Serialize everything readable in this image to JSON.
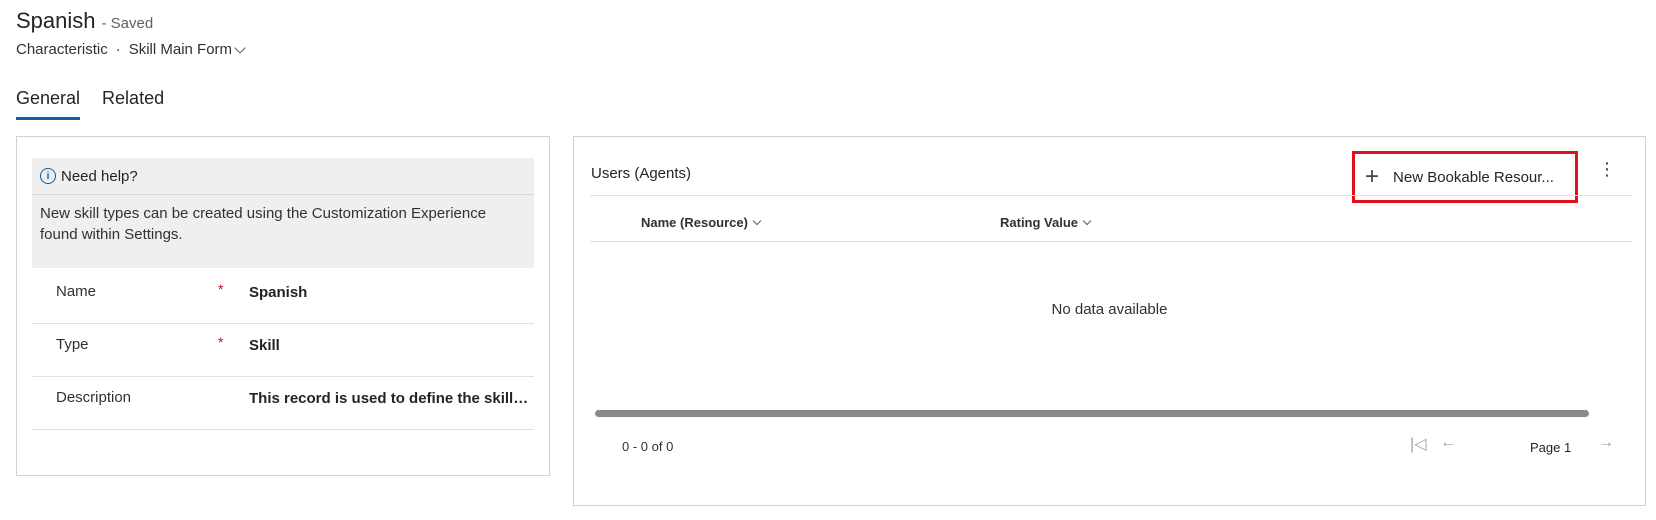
{
  "header": {
    "title": "Spanish",
    "status": "- Saved",
    "entity": "Characteristic",
    "separator": "·",
    "form_name": "Skill Main Form"
  },
  "tabs": [
    {
      "label": "General",
      "active": true
    },
    {
      "label": "Related",
      "active": false
    }
  ],
  "help": {
    "title": "Need help?",
    "body": "New skill types can be created using the Customization Experience found within Settings."
  },
  "fields": [
    {
      "label": "Name",
      "required": "*",
      "value": "Spanish"
    },
    {
      "label": "Type",
      "required": "*",
      "value": "Skill"
    },
    {
      "label": "Description",
      "required": "",
      "value": "This record is used to define the skill l..."
    }
  ],
  "grid": {
    "title": "Users (Agents)",
    "new_button": "New Bookable Resour...",
    "more_icon": "more-vertical-icon",
    "columns": [
      "Name (Resource)",
      "Rating Value"
    ],
    "empty_text": "No data available",
    "count": "0 - 0 of 0",
    "page_label": "Page 1"
  },
  "colors": {
    "accent": "#115ea3",
    "highlight": "#e0111d",
    "required": "#c50f1f"
  }
}
